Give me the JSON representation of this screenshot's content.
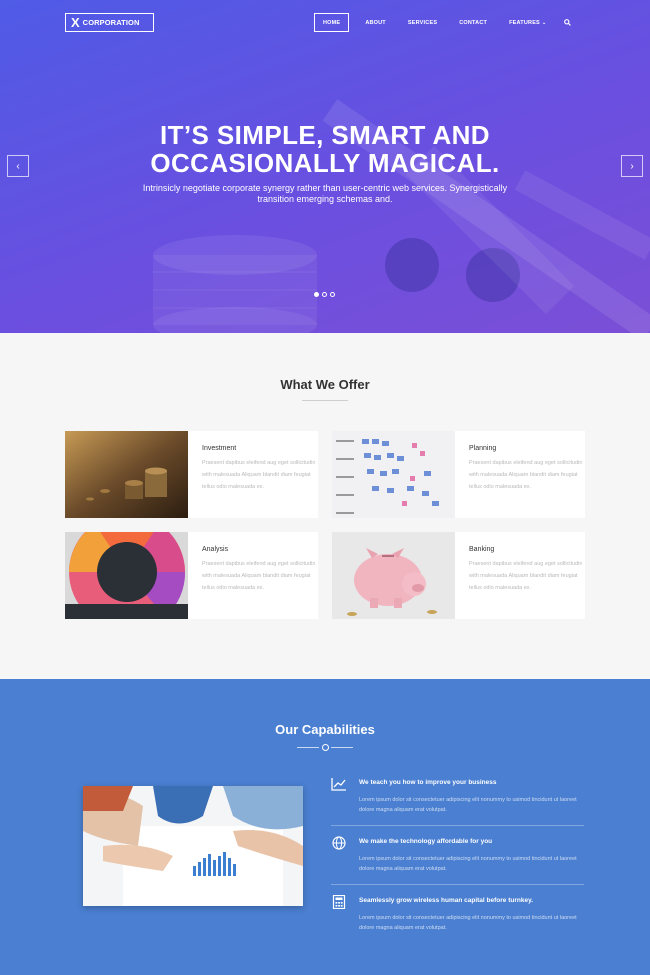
{
  "brand": {
    "mark": "X",
    "name": "CORPORATION"
  },
  "nav": {
    "home": "HOME",
    "about": "ABOUT",
    "services": "SERVICES",
    "contact": "CONTACT",
    "features": "FEATURES",
    "search_icon": "search-icon"
  },
  "hero": {
    "title_line1": "IT’S SIMPLE, SMART AND",
    "title_line2": "OCCASIONALLY MAGICAL.",
    "subtitle_line1": "Intrinsicly negotiate corporate synergy rather than user-centric web services. Synergistically",
    "subtitle_line2": "transition emerging schemas and.",
    "prev": "‹",
    "next": "›",
    "slides": 3,
    "active_slide": 1
  },
  "offer": {
    "title": "What We Offer",
    "cards": [
      {
        "title": "Investment",
        "text": "Praesent dapibus eleifend aug eget sollicitudin with malesuada Aliquam blandit diam feugiat tellus odio malesuada ex."
      },
      {
        "title": "Planning",
        "text": "Praesent dapibus eleifend aug eget sollicitudin with malesuada Aliquam blandit diam feugiat tellus odio malesuada ex."
      },
      {
        "title": "Analysis",
        "text": "Praesent dapibus eleifend aug eget sollicitudin with malesuada Aliquam blandit diam feugiat tellus odio malesuada ex."
      },
      {
        "title": "Banking",
        "text": "Praesent dapibus eleifend aug eget sollicitudin with malesuada Aliquam blandit diam feugiat tellus odio malesuada ex."
      }
    ]
  },
  "capabilities": {
    "title": "Our Capabilities",
    "features": [
      {
        "icon": "chart-line-icon",
        "title": "We teach you how to improve your business",
        "text": "Lorem ipsum dolor sit consectetuer adipiscing elit nonummy to usimod tincidunt ut laoreet dolore magna aliquam erat volutpat."
      },
      {
        "icon": "globe-icon",
        "title": "We make the technology affordable for you",
        "text": "Lorem ipsum dolor sit consectetuer adipiscing elit nonummy to usimod tincidunt ut laoreet dolore magna aliquam erat volutpat."
      },
      {
        "icon": "calculator-icon",
        "title": "Seamlessly grow wireless human capital before turnkey.",
        "text": "Lorem ipsum dolor sit consectetuer adipiscing elit nonummy to usimod tincidunt ut laoreet dolore magna aliquam erat volutpat."
      }
    ]
  },
  "colors": {
    "hero_start": "#4f5be6",
    "hero_end": "#7b4fd6",
    "capabilities_bg": "#4a7fd1",
    "offer_bg": "#f6f6f6"
  }
}
